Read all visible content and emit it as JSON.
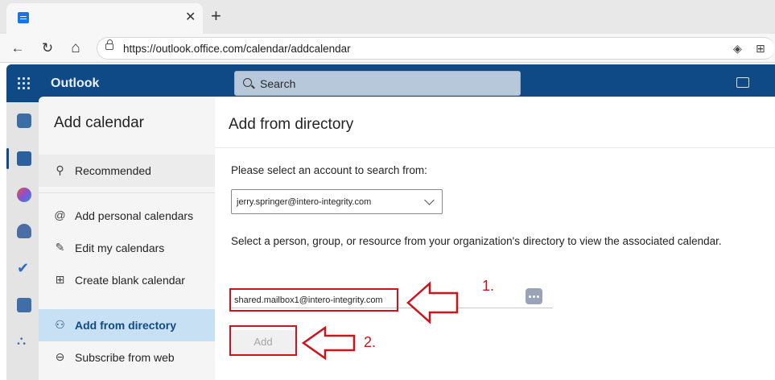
{
  "browser": {
    "tab_close": "✕",
    "new_tab": "+",
    "url": "https://outlook.office.com/calendar/addcalendar",
    "back": "←",
    "refresh": "↻",
    "home": "⌂"
  },
  "header": {
    "app_title": "Outlook",
    "search_placeholder": "Search"
  },
  "dialog": {
    "nav_title": "Add calendar",
    "nav_items": [
      {
        "label": "Recommended",
        "icon": "lightbulb-icon"
      },
      {
        "label": "Add personal calendars",
        "icon": "at-icon"
      },
      {
        "label": "Edit my calendars",
        "icon": "edit-icon"
      },
      {
        "label": "Create blank calendar",
        "icon": "calendar-add-icon"
      },
      {
        "label": "Add from directory",
        "icon": "people-icon",
        "selected": true
      },
      {
        "label": "Subscribe from web",
        "icon": "globe-icon"
      }
    ],
    "main": {
      "title": "Add from directory",
      "account_prompt": "Please select an account to search from:",
      "account_value": "jerry.springer@intero-integrity.com",
      "directory_prompt": "Select a person, group, or resource from your organization's directory to view the associated calendar.",
      "person_value": "shared.mailbox1@intero-integrity.com",
      "add_label": "Add"
    }
  },
  "annotations": {
    "step1": "1.",
    "step2": "2.",
    "color": "#d0121b"
  },
  "colors": {
    "header_bg": "#0f4a86",
    "selected_nav_bg": "#c7e0f4"
  }
}
